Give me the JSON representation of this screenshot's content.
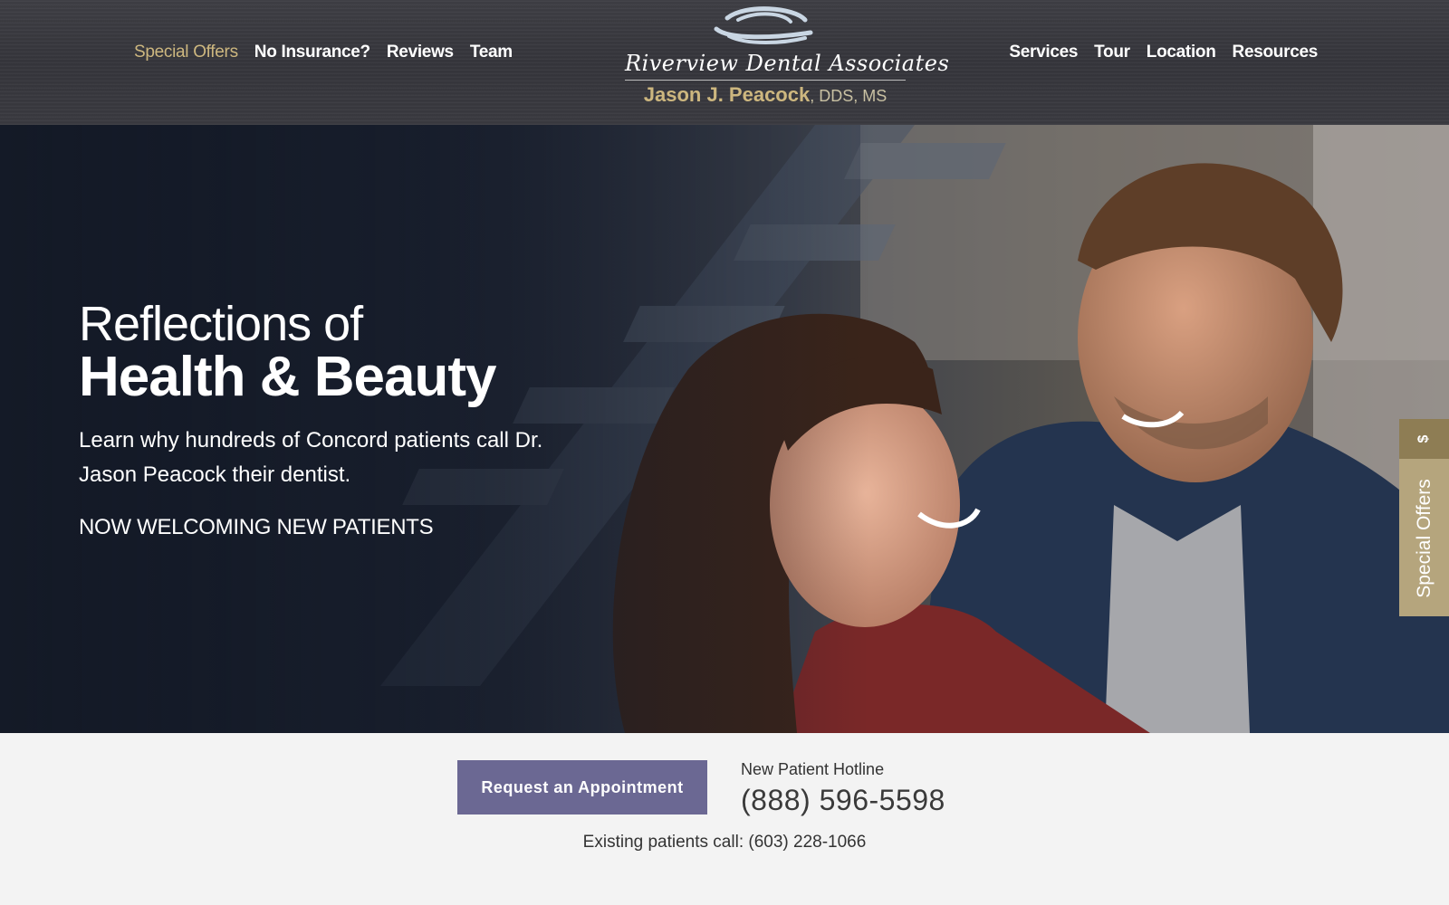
{
  "header": {
    "nav_left": [
      {
        "label": "Special Offers",
        "active": true
      },
      {
        "label": "No Insurance?"
      },
      {
        "label": "Reviews"
      },
      {
        "label": "Team"
      }
    ],
    "nav_right": [
      {
        "label": "Services"
      },
      {
        "label": "Tour"
      },
      {
        "label": "Location"
      },
      {
        "label": "Resources"
      }
    ],
    "logo": {
      "practice_name": "Riverview Dental Associates",
      "doctor_name": "Jason J. Peacock",
      "credentials": ", DDS, MS"
    }
  },
  "hero": {
    "headline_line1": "Reflections of",
    "headline_line2": "Health & Beauty",
    "subtext": "Learn why hundreds of Concord patients call Dr. Jason Peacock their dentist.",
    "welcome": "NOW WELCOMING NEW PATIENTS"
  },
  "side_tab": {
    "icon": "$",
    "label": "Special Offers"
  },
  "cta": {
    "appointment_button": "Request an Appointment",
    "hotline_label": "New Patient Hotline",
    "hotline_phone": "(888) 596-5598",
    "existing_label": "Existing patients call:",
    "existing_phone": "(603) 228-1066"
  },
  "colors": {
    "gold": "#cdb77f",
    "button_purple": "#6b6893",
    "tab_gold": "#b5a57d"
  }
}
